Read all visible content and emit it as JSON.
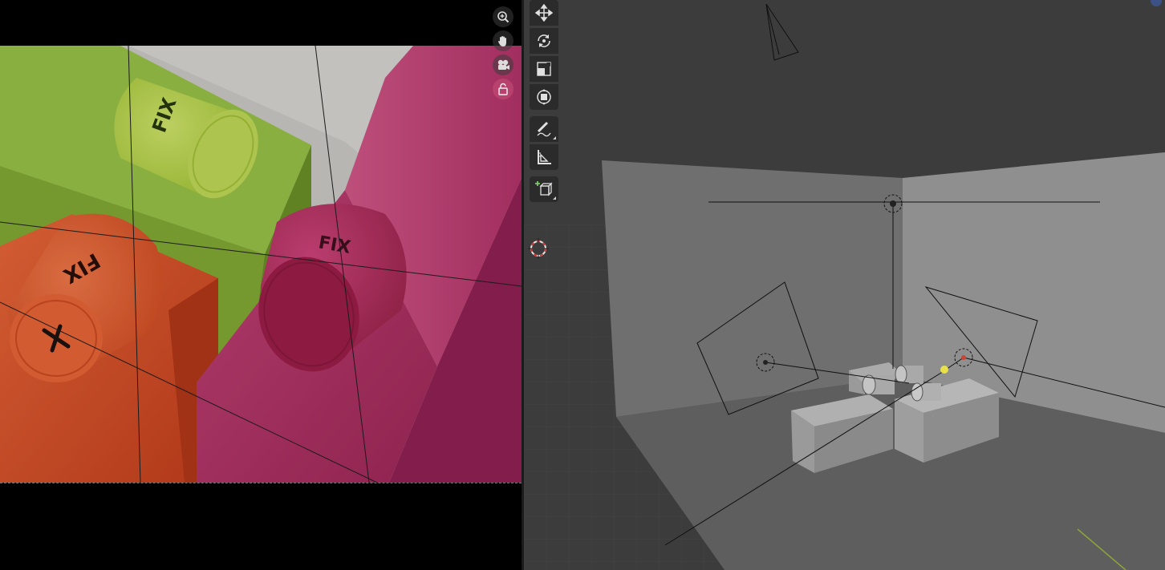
{
  "render_view": {
    "package_label": "FIX",
    "frame_aspect": "camera-view",
    "colors": {
      "green": "#93be3c",
      "orange": "#e5542a",
      "magenta": "#c2346d",
      "backdrop": "#d2d0cc"
    }
  },
  "nav_gizmos": [
    {
      "id": "zoom",
      "icon": "zoom-icon"
    },
    {
      "id": "pan",
      "icon": "hand-icon"
    },
    {
      "id": "camera",
      "icon": "camera-icon"
    },
    {
      "id": "lock",
      "icon": "lock-icon"
    }
  ],
  "toolbar": {
    "tools": [
      {
        "id": "move",
        "icon": "move-icon"
      },
      {
        "id": "rotate",
        "icon": "rotate-icon"
      },
      {
        "id": "scale",
        "icon": "scale-icon"
      },
      {
        "id": "transform",
        "icon": "transform-icon"
      },
      {
        "id": "annotate",
        "icon": "annotate-icon"
      },
      {
        "id": "measure",
        "icon": "measure-icon"
      },
      {
        "id": "add-cube",
        "icon": "add-cube-icon"
      }
    ]
  },
  "viewport_3d": {
    "background": "#3d3d3d",
    "wall_left": "#6e6e6e",
    "wall_right": "#8d8d8d",
    "floor": "#5a5a5a",
    "light_color": "#e8e04a"
  }
}
